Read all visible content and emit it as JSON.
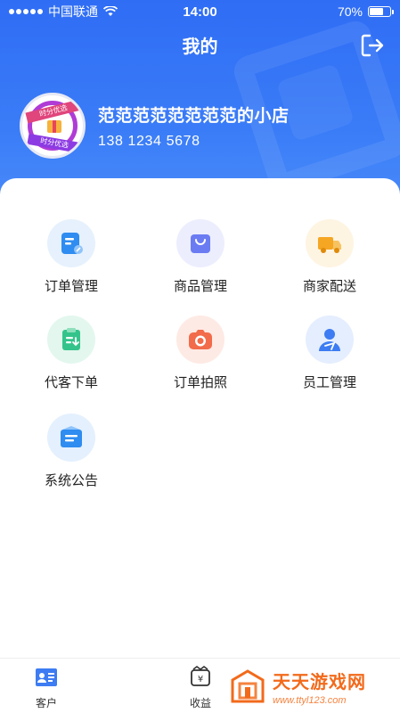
{
  "status_bar": {
    "carrier": "中国联通",
    "time": "14:00",
    "battery": "70%",
    "battery_level": 0.7
  },
  "header": {
    "title": "我的"
  },
  "profile": {
    "shop_name": "范范范范范范范范的小店",
    "phone": "138 1234 5678",
    "avatar_badge_top": "时分优选",
    "avatar_badge_bottom": "时分优选"
  },
  "menu": [
    {
      "label": "订单管理",
      "icon": "order-icon",
      "color": "#2f8cf0"
    },
    {
      "label": "商品管理",
      "icon": "bag-icon",
      "color": "#6b7cf3"
    },
    {
      "label": "商家配送",
      "icon": "truck-icon",
      "color": "#f5a623"
    },
    {
      "label": "代客下单",
      "icon": "clipboard-icon",
      "color": "#34c48b"
    },
    {
      "label": "订单拍照",
      "icon": "camera-icon",
      "color": "#f26b4a"
    },
    {
      "label": "员工管理",
      "icon": "staff-icon",
      "color": "#3d7cf2"
    },
    {
      "label": "系统公告",
      "icon": "announcement-icon",
      "color": "#2f8cf0"
    }
  ],
  "tabbar": {
    "tabs": [
      {
        "label": "客户",
        "icon": "customer-icon"
      },
      {
        "label": "收益",
        "icon": "income-icon"
      }
    ]
  },
  "watermark": {
    "title": "天天游戏网",
    "url": "www.ttyl123.com"
  }
}
